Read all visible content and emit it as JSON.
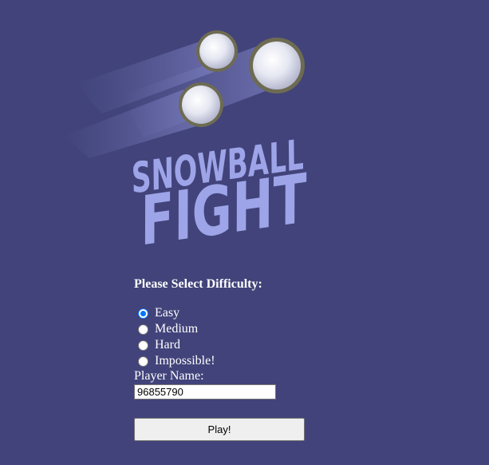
{
  "logo": {
    "line1": "SNOWBALL",
    "line2": "FIGHT",
    "text_color": "#9ea4e8",
    "background_color": "#41437a"
  },
  "form": {
    "title": "Please Select Difficulty:",
    "difficulty_options": [
      {
        "label": "Easy",
        "selected": true
      },
      {
        "label": "Medium",
        "selected": false
      },
      {
        "label": "Hard",
        "selected": false
      },
      {
        "label": "Impossible!",
        "selected": false
      }
    ],
    "player_name_label": "Player Name:",
    "player_name_value": "96855790",
    "play_button_label": "Play!"
  }
}
